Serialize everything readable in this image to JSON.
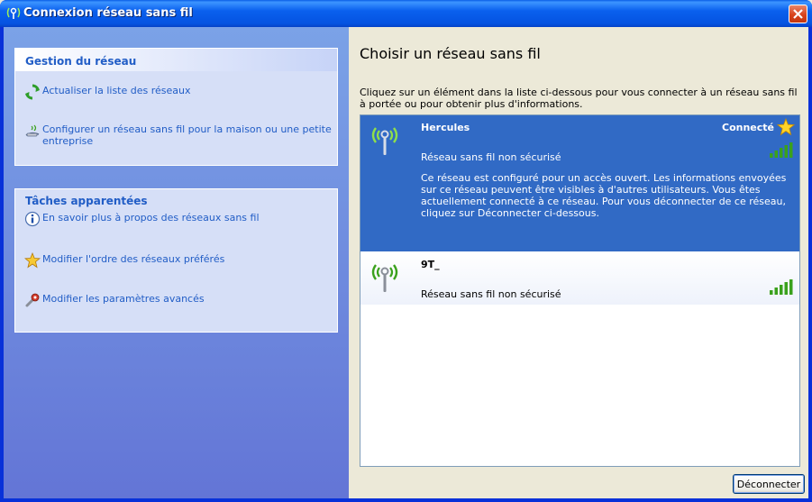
{
  "window": {
    "title": "Connexion réseau sans fil"
  },
  "sidebar": {
    "network_tasks": {
      "header": "Gestion du réseau",
      "items": [
        {
          "label": "Actualiser la liste des réseaux",
          "icon": "refresh-icon"
        },
        {
          "label": "Configurer un réseau sans fil pour la maison ou une petite entreprise",
          "icon": "home-network-icon"
        }
      ]
    },
    "related_tasks": {
      "header": "Tâches apparentées",
      "items": [
        {
          "label": "En savoir plus à propos des réseaux sans fil",
          "icon": "info-icon"
        },
        {
          "label": "Modifier l'ordre des réseaux préférés",
          "icon": "star-icon"
        },
        {
          "label": "Modifier les paramètres avancés",
          "icon": "settings-icon"
        }
      ]
    }
  },
  "main": {
    "heading": "Choisir un réseau sans fil",
    "intro": "Cliquez sur un élément dans la liste ci-dessous pour vous connecter à un réseau sans fil à portée ou pour obtenir plus d'informations.",
    "networks": [
      {
        "ssid": "Hercules",
        "status": "Connecté",
        "security": "Réseau sans fil non sécurisé",
        "description": "Ce réseau est configuré pour un accès ouvert. Les informations envoyées sur ce réseau peuvent être visibles à d'autres utilisateurs. Vous êtes actuellement connecté à ce réseau. Pour vous déconnecter de ce réseau, cliquez sur Déconnecter ci-dessous.",
        "selected": true,
        "signal_bars": 5
      },
      {
        "ssid": "9T_",
        "status": "",
        "security": "Réseau sans fil non sécurisé",
        "description": "",
        "selected": false,
        "signal_bars": 5
      }
    ],
    "disconnect_label": "Déconnecter"
  },
  "colors": {
    "title_bar": "#0a60ee",
    "sidebar_gradient_top": "#7ba2e7",
    "sidebar_gradient_bottom": "#6375d6",
    "task_link": "#215dc6",
    "selection": "#316ac5",
    "signal_green": "#3aa11c"
  }
}
